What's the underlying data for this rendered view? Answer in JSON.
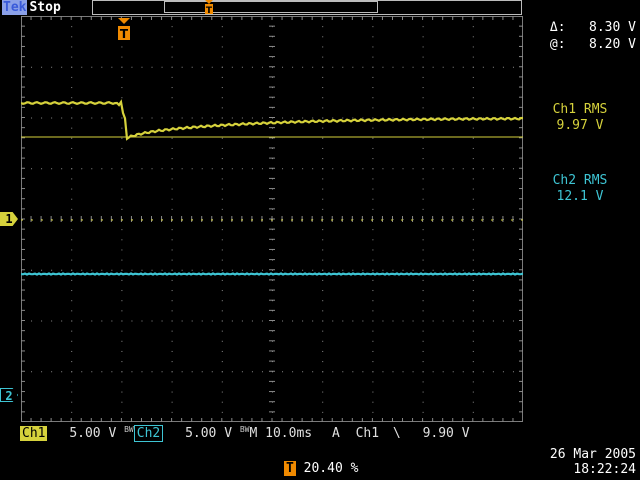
{
  "status": {
    "brand": "Tek",
    "state": "Stop"
  },
  "record_bar": {
    "trigger_marker": "T"
  },
  "trigger_marker_top": "T",
  "measurements": {
    "delta_label": "Δ:",
    "delta_value": "8.30 V",
    "at_label": "@:",
    "at_value": "8.20 V",
    "ch1_rms_label": "Ch1 RMS",
    "ch1_rms_value": "9.97 V",
    "ch2_rms_label": "Ch2 RMS",
    "ch2_rms_value": "12.1 V"
  },
  "channel_markers": {
    "ch1": "1",
    "ch2": "2"
  },
  "bottom": {
    "ch1_label": "Ch1",
    "ch1_scale": "5.00 V",
    "bw1": "BW",
    "ch2_label": "Ch2",
    "ch2_scale": "5.00 V",
    "bw2": "BW",
    "timebase": "M 10.0ms",
    "trig_mode": "A",
    "trig_source": "Ch1",
    "trig_slope": "\\",
    "trig_level": "9.90 V"
  },
  "trigger_position": {
    "icon": "T",
    "value": "20.40 %"
  },
  "timestamp": {
    "date": "26 Mar 2005",
    "time": "18:22:24"
  },
  "colors": {
    "ch1": "#d6d23c",
    "ch2": "#3ec5d4",
    "trigger": "#f08a00",
    "grid": "#8a8a8a"
  }
}
